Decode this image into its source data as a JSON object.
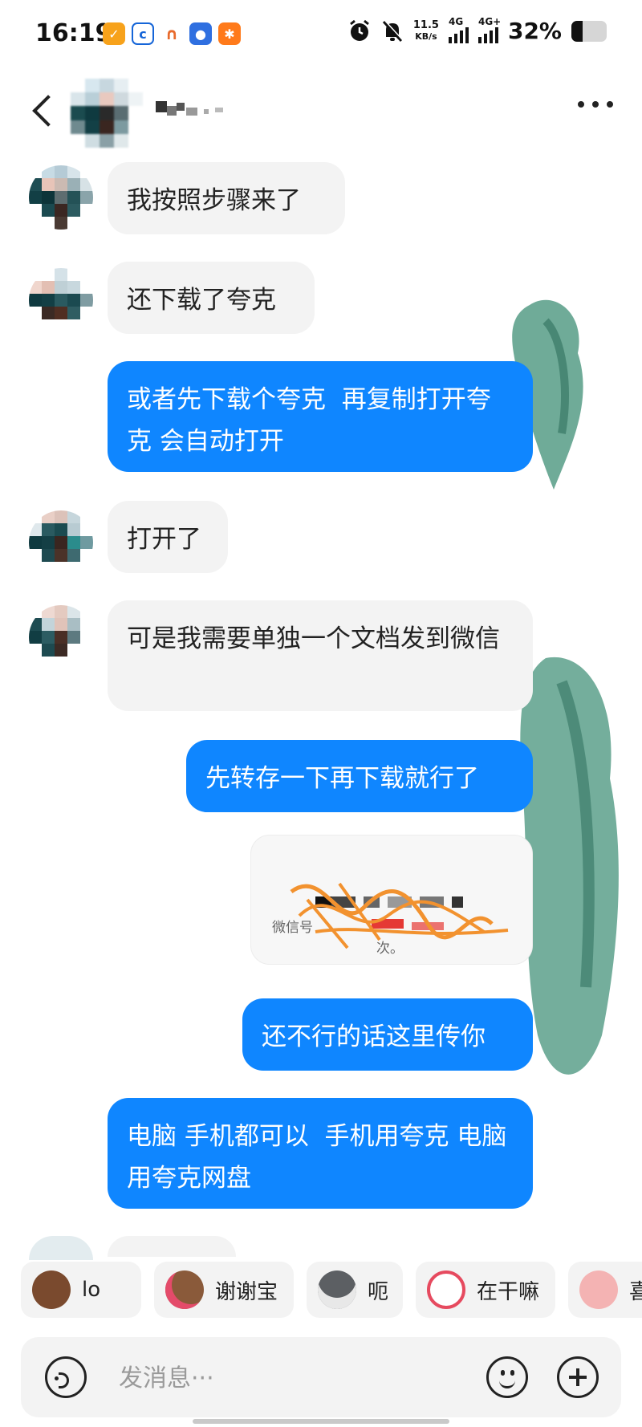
{
  "status_bar": {
    "time": "16:19",
    "net_speed_value": "11.5",
    "net_speed_unit": "KB/s",
    "network_1": "4G",
    "network_2": "4G+",
    "battery_percent": "32%",
    "battery_level": 0.32
  },
  "header": {
    "back_icon": "chevron-left-icon",
    "more_icon": "more-dots-icon"
  },
  "messages": [
    {
      "side": "in",
      "text": "我按照步骤来了"
    },
    {
      "side": "in",
      "text": "还下载了夸克"
    },
    {
      "side": "out",
      "text": "或者先下载个夸克  再复制打开夸克 会自动打开"
    },
    {
      "side": "in",
      "text": "打开了"
    },
    {
      "side": "in",
      "text": "可是我需要单独一个文档发到微信"
    },
    {
      "side": "out",
      "text": "先转存一下再下载就行了"
    },
    {
      "side": "out",
      "text": "还不行的话这里传你"
    },
    {
      "side": "out",
      "text": "电脑 手机都可以  手机用夸克 电脑用夸克网盘"
    }
  ],
  "shared_card": {
    "caption_line1": "微信号",
    "caption_line2": "次。"
  },
  "quick_replies": [
    {
      "label": "lo",
      "sticker": "monkey-sticker"
    },
    {
      "label": "谢谢宝",
      "sticker": "monkey-flower-sticker"
    },
    {
      "label": "呃",
      "sticker": "cat-sticker"
    },
    {
      "label": "在干嘛",
      "sticker": "bird-sticker"
    },
    {
      "label": "喜",
      "sticker": "pig-sticker"
    }
  ],
  "input": {
    "placeholder": "发消息···",
    "voice_icon": "voice-icon",
    "emoji_icon": "emoji-icon",
    "plus_icon": "plus-icon"
  },
  "colors": {
    "outgoing_bubble": "#0f86ff",
    "incoming_bubble": "#f3f3f3",
    "brush_green": "#3f8f76"
  }
}
